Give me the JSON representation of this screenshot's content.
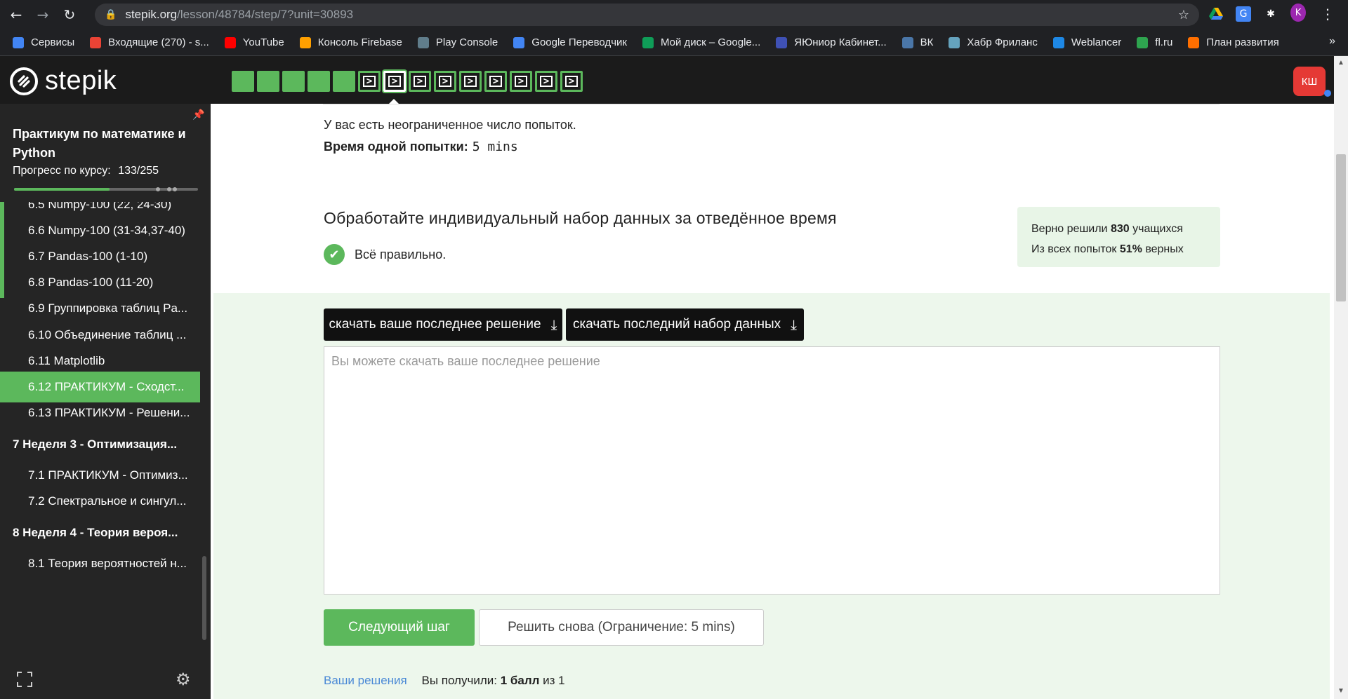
{
  "browser": {
    "url_host": "stepik.org",
    "url_path": "/lesson/48784/step/7?unit=30893",
    "profile_initial": "K",
    "bookmarks": [
      {
        "label": "Сервисы",
        "icon": "apps-grid-icon",
        "color": "#4285f4"
      },
      {
        "label": "Входящие (270) - s...",
        "icon": "gmail-icon",
        "color": "#ea4335"
      },
      {
        "label": "YouTube",
        "icon": "youtube-icon",
        "color": "#ff0000"
      },
      {
        "label": "Консоль Firebase",
        "icon": "firebase-icon",
        "color": "#ffa000"
      },
      {
        "label": "Play Console",
        "icon": "play-console-icon",
        "color": "#607d8b"
      },
      {
        "label": "Google Переводчик",
        "icon": "google-translate-icon",
        "color": "#4285f4"
      },
      {
        "label": "Мой диск – Google...",
        "icon": "google-drive-icon",
        "color": "#0f9d58"
      },
      {
        "label": "ЯЮниор Кабинет...",
        "icon": "yajunior-icon",
        "color": "#3f51b5"
      },
      {
        "label": "ВК",
        "icon": "vk-icon",
        "color": "#4a76a8"
      },
      {
        "label": "Хабр Фриланс",
        "icon": "habr-icon",
        "color": "#65a3be"
      },
      {
        "label": "Weblancer",
        "icon": "weblancer-icon",
        "color": "#1e88e5"
      },
      {
        "label": "fl.ru",
        "icon": "flru-icon",
        "color": "#2ea44f"
      },
      {
        "label": "План развития",
        "icon": "plan-icon",
        "color": "#ff6f00"
      }
    ],
    "bookmarks_more": "»"
  },
  "header": {
    "logo_text": "stepik",
    "user_initials": "КШ",
    "steps": [
      "done",
      "done",
      "done",
      "done",
      "done",
      "code",
      "code-current",
      "code",
      "code",
      "code",
      "code",
      "code",
      "code",
      "code"
    ]
  },
  "sidebar": {
    "course_title": "Практикум по математике и Python",
    "progress_label": "Прогресс по курсу:",
    "progress_value": "133/255",
    "progress_fraction": 0.52,
    "items": [
      {
        "label": "6.5  Numpy-100 (22, 24-30)",
        "kind": "lesson"
      },
      {
        "label": "6.6  Numpy-100 (31-34,37-40)",
        "kind": "lesson"
      },
      {
        "label": "6.7  Pandas-100 (1-10)",
        "kind": "lesson"
      },
      {
        "label": "6.8  Pandas-100 (11-20)",
        "kind": "lesson"
      },
      {
        "label": "6.9  Группировка таблиц Pa...",
        "kind": "plain"
      },
      {
        "label": "6.10  Объединение таблиц ...",
        "kind": "plain"
      },
      {
        "label": "6.11  Matplotlib",
        "kind": "plain"
      },
      {
        "label": "6.12  ПРАКТИКУМ - Сходст...",
        "kind": "active"
      },
      {
        "label": "6.13  ПРАКТИКУМ - Решени...",
        "kind": "plain"
      },
      {
        "label": "7  Неделя 3 - Оптимизация...",
        "kind": "section"
      },
      {
        "label": "7.1  ПРАКТИКУМ - Оптимиз...",
        "kind": "plain"
      },
      {
        "label": "7.2  Спектральное и сингул...",
        "kind": "plain"
      },
      {
        "label": "8  Неделя 4 - Теория вероя...",
        "kind": "section"
      },
      {
        "label": "8.1  Теория вероятностей н...",
        "kind": "plain"
      }
    ]
  },
  "main": {
    "attempts_text": "У вас есть неограниченное число попыток.",
    "time_label": "Время одной попытки:",
    "time_value": "5 mins",
    "task_title": "Обработайте индивидуальный набор данных за отведённое время",
    "status_text": "Всё правильно.",
    "stats": {
      "solved_prefix": "Верно решили",
      "solved_count": "830",
      "solved_suffix": "учащихся",
      "attempts_prefix": "Из всех попыток",
      "attempts_percent": "51%",
      "attempts_suffix": "верных"
    },
    "download_solution_label": "скачать ваше последнее решение",
    "download_dataset_label": "скачать последний набор данных",
    "solution_placeholder": "Вы можете скачать ваше последнее решение",
    "next_step_label": "Следующий шаг",
    "retry_label": "Решить снова (Ограничение: 5 mins)",
    "your_solutions_link": "Ваши решения",
    "score_prefix": "Вы получили:",
    "score_value": "1 балл",
    "score_suffix": "из 1"
  }
}
